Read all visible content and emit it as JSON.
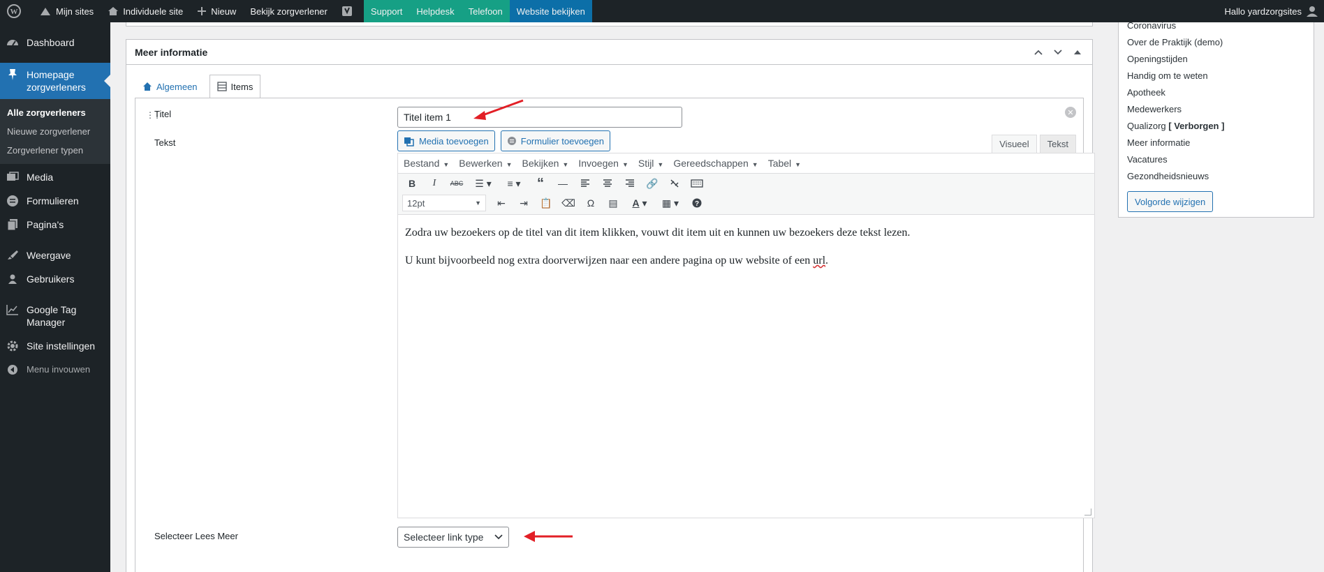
{
  "adminbar": {
    "my_sites": "Mijn sites",
    "site": "Individuele site",
    "new": "Nieuw",
    "view_provider": "Bekijk zorgverlener",
    "support": "Support",
    "helpdesk": "Helpdesk",
    "phone": "Telefoon",
    "view_website": "Website bekijken",
    "greeting": "Hallo yardzorgsites"
  },
  "sidebar": {
    "dashboard": "Dashboard",
    "homepage": "Homepage zorgverleners",
    "sub": [
      "Alle zorgverleners",
      "Nieuwe zorgverlener",
      "Zorgverlener typen"
    ],
    "media": "Media",
    "forms": "Formulieren",
    "pages": "Pagina's",
    "appearance": "Weergave",
    "users": "Gebruikers",
    "gtm": "Google Tag Manager",
    "site_settings": "Site instellingen",
    "collapse": "Menu invouwen"
  },
  "postbox": {
    "title": "Meer informatie",
    "tabs": [
      "Algemeen",
      "Items"
    ],
    "labels": {
      "title": "Titel",
      "text": "Tekst",
      "read_more": "Selecteer Lees Meer"
    },
    "title_value": "Titel item 1",
    "media_button": "Media toevoegen",
    "form_button": "Formulier toevoegen",
    "editor_tabs": [
      "Visueel",
      "Tekst"
    ],
    "menubar": [
      "Bestand",
      "Bewerken",
      "Bekijken",
      "Invoegen",
      "Stijl",
      "Gereedschappen",
      "Tabel"
    ],
    "fontsize": "12pt",
    "content": {
      "p1": "Zodra uw bezoekers op de titel van dit item klikken, vouwt dit item uit en kunnen uw bezoekers deze tekst lezen.",
      "p2_a": "U kunt bijvoorbeeld nog extra doorverwijzen naar een andere pagina op uw website of een ",
      "p2_b": "url",
      "p2_c": "."
    },
    "link_type": "Selecteer link type"
  },
  "rightpanel": {
    "items": [
      "Coronavirus",
      "Over de Praktijk (demo)",
      "Openingstijden",
      "Handig om te weten",
      "Apotheek",
      "Medewerkers"
    ],
    "hidden_item": "Qualizorg",
    "hidden_tag": "[ Verborgen ]",
    "items2": [
      "Meer informatie",
      "Vacatures",
      "Gezondheidsnieuws"
    ],
    "order_button": "Volgorde wijzigen"
  },
  "colors": {
    "admin_dark": "#1d2327",
    "accent_blue": "#2271b1",
    "support_green": "#16a085",
    "annotation_red": "#e21f26"
  }
}
